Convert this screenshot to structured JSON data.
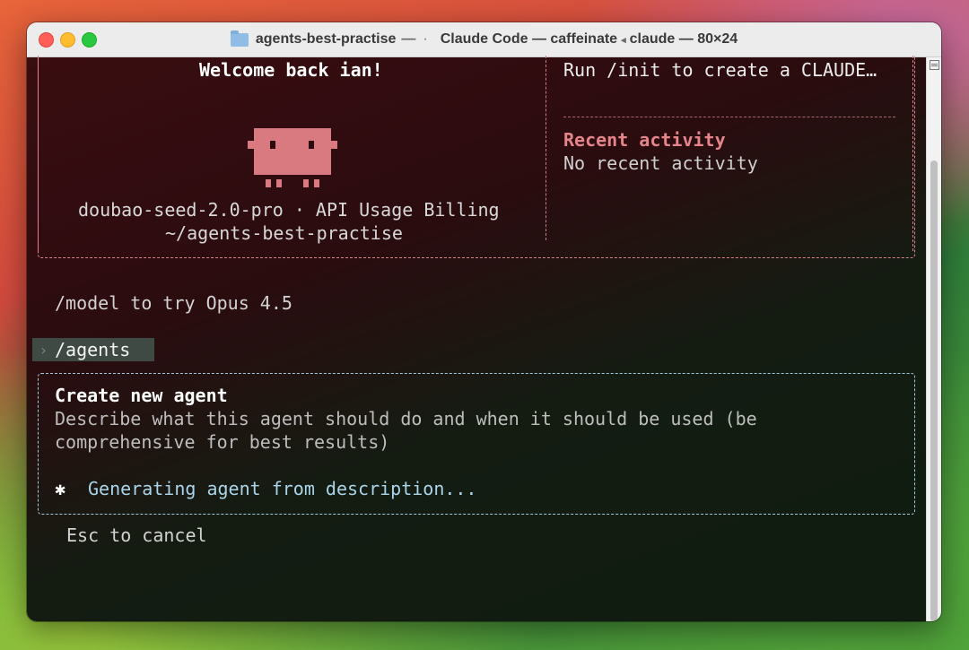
{
  "window": {
    "folder_name": "agents-best-practise",
    "title_separator": "—",
    "title_dot": "·",
    "title_right": "Claude Code — caffeinate",
    "title_arrow": "◂",
    "title_process": "claude — 80×24"
  },
  "header_panel": {
    "welcome": "Welcome back ian!",
    "model_billing": "doubao-seed-2.0-pro · API Usage Billing",
    "cwd": "~/agents-best-practise",
    "tip": "Run /init to create a CLAUDE…",
    "recent_activity_title": "Recent activity",
    "recent_activity_value": "No recent activity"
  },
  "hint": "/model to try Opus 4.5",
  "prompt": {
    "chevron": "›",
    "command": "/agents"
  },
  "agent_dialog": {
    "title": "Create new agent",
    "description_line1": "Describe what this agent should do and when it should be used (be",
    "description_line2": "comprehensive for best results)",
    "status_icon": "✱",
    "status_text": "Generating agent from description..."
  },
  "cancel_hint": "Esc to cancel",
  "colors": {
    "accent_red": "#e5848b",
    "accent_blue": "#a9d4ea"
  }
}
